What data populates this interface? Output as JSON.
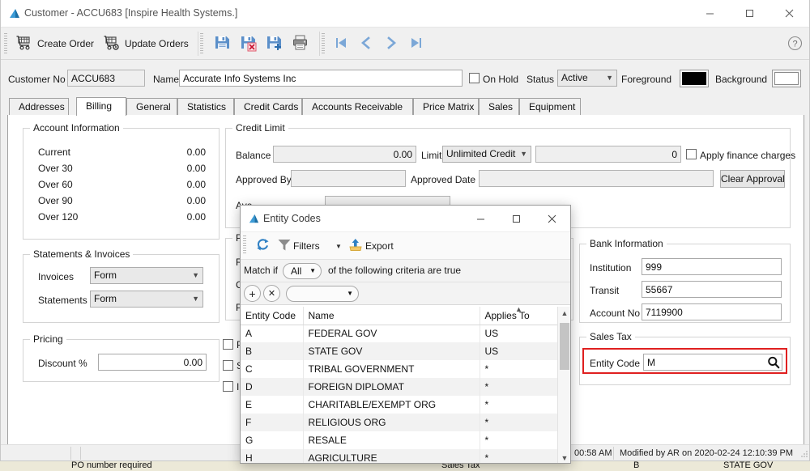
{
  "window": {
    "title": "Customer - ACCU683 [Inspire Health Systems.]",
    "minimize_label": "–",
    "maximize_label": "□",
    "close_label": "✕",
    "help_label": "?"
  },
  "toolbar": {
    "create_order": "Create Order",
    "update_orders": "Update Orders",
    "save_icon": "save-icon",
    "save_cancel_icon": "save-cancel-icon",
    "save_new_icon": "save-new-icon",
    "print_icon": "print-icon",
    "first_icon": "nav-first-icon",
    "prev_icon": "nav-prev-icon",
    "next_icon": "nav-next-icon",
    "last_icon": "nav-last-icon"
  },
  "header": {
    "customer_no_label": "Customer No",
    "customer_no_value": "ACCU683",
    "name_label": "Name",
    "name_value": "Accurate Info Systems Inc",
    "on_hold_label": "On Hold",
    "on_hold_checked": false,
    "status_label": "Status",
    "status_value": "Active",
    "foreground_label": "Foreground",
    "foreground_color": "#000000",
    "background_label": "Background",
    "background_color": "#ffffff"
  },
  "tabs": [
    {
      "label": "Addresses",
      "active": false
    },
    {
      "label": "Billing",
      "active": true
    },
    {
      "label": "General",
      "active": false
    },
    {
      "label": "Statistics",
      "active": false
    },
    {
      "label": "Credit Cards",
      "active": false
    },
    {
      "label": "Accounts Receivable",
      "active": false
    },
    {
      "label": "Price Matrix",
      "active": false
    },
    {
      "label": "Sales",
      "active": false
    },
    {
      "label": "Equipment",
      "active": false
    }
  ],
  "account_information": {
    "title": "Account Information",
    "rows": [
      {
        "label": "Current",
        "value": "0.00"
      },
      {
        "label": "Over 30",
        "value": "0.00"
      },
      {
        "label": "Over 60",
        "value": "0.00"
      },
      {
        "label": "Over 90",
        "value": "0.00"
      },
      {
        "label": "Over 120",
        "value": "0.00"
      }
    ]
  },
  "statements_invoices": {
    "title": "Statements & Invoices",
    "invoices_label": "Invoices",
    "invoices_value": "Form",
    "statements_label": "Statements",
    "statements_value": "Form"
  },
  "pricing": {
    "title": "Pricing",
    "discount_label": "Discount %",
    "discount_value": "0.00"
  },
  "credit_limit": {
    "title": "Credit Limit",
    "balance_label": "Balance",
    "balance_value": "0.00",
    "limit_label": "Limit",
    "limit_value": "Unlimited Credit",
    "limit_amount": "0",
    "apply_finance_label": "Apply finance charges",
    "apply_finance_checked": false,
    "approved_by_label": "Approved By",
    "approved_by_value": "",
    "approved_date_label": "Approved Date",
    "approved_date_value": "",
    "clear_approval_label": "Clear Approval",
    "average_label": "Ave"
  },
  "payment_group": {
    "title": "Payr",
    "row1_label": "Rec",
    "row2_label": "Cur",
    "row3_label": "Pay"
  },
  "options_checkboxes": [
    {
      "label": "PO",
      "checked": false
    },
    {
      "label": "Se",
      "checked": false
    },
    {
      "label": "Inv",
      "checked": false
    }
  ],
  "bank_information": {
    "title": "Bank Information",
    "institution_label": "Institution",
    "institution_value": "999",
    "transit_label": "Transit",
    "transit_value": "55667",
    "account_no_label": "Account No",
    "account_no_value": "7119900"
  },
  "sales_tax": {
    "title": "Sales Tax",
    "entity_code_label": "Entity Code",
    "entity_code_value": "M",
    "search_icon": "magnifier-icon",
    "highlight_color": "#e02020"
  },
  "status_bar": {
    "time_text": "00:58 AM",
    "modified_text": "Modified by AR on 2020-02-24 12:10:39 PM"
  },
  "background_app": {
    "po_required": "PO number required",
    "sales_tax": "Sales Tax",
    "code": "B",
    "name": "STATE GOV"
  },
  "modal": {
    "title": "Entity Codes",
    "minimize_label": "–",
    "maximize_label": "□",
    "close_label": "✕",
    "refresh_icon": "refresh-icon",
    "filters_label": "Filters",
    "filters_icon": "funnel-icon",
    "filters_dropdown_icon": "chevron-down-icon",
    "export_label": "Export",
    "export_icon": "export-upload-icon",
    "match_if_label": "Match if",
    "match_if_value": "All",
    "criteria_suffix": "of the following criteria are true",
    "add_criteria_label": "+",
    "remove_criteria_label": "✕",
    "criteria_field_value": "",
    "columns": [
      "Entity Code",
      "Name",
      "Applies To"
    ],
    "sorted_column": "Applies To",
    "sort_direction": "asc",
    "rows": [
      {
        "code": "A",
        "name": "FEDERAL GOV",
        "applies_to": "US"
      },
      {
        "code": "B",
        "name": "STATE GOV",
        "applies_to": "US"
      },
      {
        "code": "C",
        "name": "TRIBAL GOVERNMENT",
        "applies_to": "*"
      },
      {
        "code": "D",
        "name": "FOREIGN DIPLOMAT",
        "applies_to": "*"
      },
      {
        "code": "E",
        "name": "CHARITABLE/EXEMPT ORG",
        "applies_to": "*"
      },
      {
        "code": "F",
        "name": "RELIGIOUS ORG",
        "applies_to": "*"
      },
      {
        "code": "G",
        "name": "RESALE",
        "applies_to": "*"
      },
      {
        "code": "H",
        "name": "AGRICULTURE",
        "applies_to": "*"
      }
    ]
  }
}
